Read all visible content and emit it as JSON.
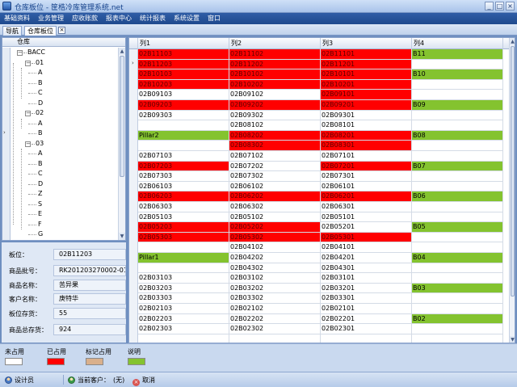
{
  "window": {
    "title": "仓库板位 - 筐梏冷库管理系统.net",
    "controls": [
      "_",
      "□",
      "×"
    ]
  },
  "menu": [
    "基础资料",
    "业务管理",
    "应收账款",
    "报表中心",
    "统计报表",
    "系统设置",
    "窗口"
  ],
  "tabs": {
    "nav": "导航",
    "warehouse": "仓库板位"
  },
  "tree": {
    "header": "仓库",
    "nodes": [
      {
        "label": "BACC",
        "level": 0,
        "expander": "−"
      },
      {
        "label": "01",
        "level": 1,
        "expander": "−"
      },
      {
        "label": "A",
        "level": 2
      },
      {
        "label": "B",
        "level": 2
      },
      {
        "label": "C",
        "level": 2
      },
      {
        "label": "D",
        "level": 2
      },
      {
        "label": "02",
        "level": 1,
        "expander": "−"
      },
      {
        "label": "A",
        "level": 2
      },
      {
        "label": "B",
        "level": 2
      },
      {
        "label": "03",
        "level": 1,
        "expander": "−"
      },
      {
        "label": "A",
        "level": 2
      },
      {
        "label": "B",
        "level": 2
      },
      {
        "label": "C",
        "level": 2
      },
      {
        "label": "D",
        "level": 2
      },
      {
        "label": "Z",
        "level": 2
      },
      {
        "label": "S",
        "level": 2
      },
      {
        "label": "E",
        "level": 2
      },
      {
        "label": "F",
        "level": 2
      },
      {
        "label": "G",
        "level": 2
      }
    ],
    "pointer": "›",
    "pointer_row": 8
  },
  "info": [
    {
      "label": "板位：",
      "value": "02B11203"
    },
    {
      "label": "商品批号：",
      "value": "RK201203270002-01"
    },
    {
      "label": "商品名称：",
      "value": "苦异果"
    },
    {
      "label": "客户名称：",
      "value": "庚特华"
    },
    {
      "label": "板位存货：",
      "value": "55"
    },
    {
      "label": "商品总存货：",
      "value": "924"
    }
  ],
  "grid": {
    "columns": [
      "列1",
      "列2",
      "列3",
      "列4"
    ],
    "pointer": "›",
    "pointer_row": 1,
    "rows": [
      [
        {
          "t": "02B11103",
          "c": "red"
        },
        {
          "t": "02B11102",
          "c": "red"
        },
        {
          "t": "02B11101",
          "c": "red"
        },
        {
          "t": "B11",
          "c": "green"
        }
      ],
      [
        {
          "t": "02B11203",
          "c": "red"
        },
        {
          "t": "02B11202",
          "c": "red"
        },
        {
          "t": "02B11201",
          "c": "red"
        },
        {
          "t": "",
          "c": "white"
        }
      ],
      [
        {
          "t": "02B10103",
          "c": "red"
        },
        {
          "t": "02B10102",
          "c": "red"
        },
        {
          "t": "02B10101",
          "c": "red"
        },
        {
          "t": "B10",
          "c": "green"
        }
      ],
      [
        {
          "t": "02B10203",
          "c": "red"
        },
        {
          "t": "02B10202",
          "c": "red"
        },
        {
          "t": "02B10201",
          "c": "red"
        },
        {
          "t": "",
          "c": "white"
        }
      ],
      [
        {
          "t": "02B09103",
          "c": "white"
        },
        {
          "t": "02B09102",
          "c": "white"
        },
        {
          "t": "02B09101",
          "c": "red"
        },
        {
          "t": "",
          "c": "white"
        }
      ],
      [
        {
          "t": "02B09203",
          "c": "red"
        },
        {
          "t": "02B09202",
          "c": "red"
        },
        {
          "t": "02B09201",
          "c": "red"
        },
        {
          "t": "B09",
          "c": "green"
        }
      ],
      [
        {
          "t": "02B09303",
          "c": "white"
        },
        {
          "t": "02B09302",
          "c": "white"
        },
        {
          "t": "02B09301",
          "c": "white"
        },
        {
          "t": "",
          "c": "white"
        }
      ],
      [
        {
          "t": "",
          "c": "white"
        },
        {
          "t": "02B08102",
          "c": "white"
        },
        {
          "t": "02B08101",
          "c": "white"
        },
        {
          "t": "",
          "c": "white"
        }
      ],
      [
        {
          "t": "Pillar2",
          "c": "green"
        },
        {
          "t": "02B08202",
          "c": "red"
        },
        {
          "t": "02B08201",
          "c": "red"
        },
        {
          "t": "B08",
          "c": "green"
        }
      ],
      [
        {
          "t": "",
          "c": "white"
        },
        {
          "t": "02B08302",
          "c": "red"
        },
        {
          "t": "02B08301",
          "c": "red"
        },
        {
          "t": "",
          "c": "white"
        }
      ],
      [
        {
          "t": "02B07103",
          "c": "white"
        },
        {
          "t": "02B07102",
          "c": "white"
        },
        {
          "t": "02B07101",
          "c": "white"
        },
        {
          "t": "",
          "c": "white"
        }
      ],
      [
        {
          "t": "02B07203",
          "c": "red"
        },
        {
          "t": "02B07202",
          "c": "white"
        },
        {
          "t": "02B07201",
          "c": "red"
        },
        {
          "t": "B07",
          "c": "green"
        }
      ],
      [
        {
          "t": "02B07303",
          "c": "white"
        },
        {
          "t": "02B07302",
          "c": "white"
        },
        {
          "t": "02B07301",
          "c": "white"
        },
        {
          "t": "",
          "c": "white"
        }
      ],
      [
        {
          "t": "02B06103",
          "c": "white"
        },
        {
          "t": "02B06102",
          "c": "white"
        },
        {
          "t": "02B06101",
          "c": "white"
        },
        {
          "t": "",
          "c": "white"
        }
      ],
      [
        {
          "t": "02B06203",
          "c": "red"
        },
        {
          "t": "02B06202",
          "c": "red"
        },
        {
          "t": "02B06201",
          "c": "red"
        },
        {
          "t": "B06",
          "c": "green"
        }
      ],
      [
        {
          "t": "02B06303",
          "c": "white"
        },
        {
          "t": "02B06302",
          "c": "white"
        },
        {
          "t": "02B06301",
          "c": "white"
        },
        {
          "t": "",
          "c": "white"
        }
      ],
      [
        {
          "t": "02B05103",
          "c": "white"
        },
        {
          "t": "02B05102",
          "c": "white"
        },
        {
          "t": "02B05101",
          "c": "white"
        },
        {
          "t": "",
          "c": "white"
        }
      ],
      [
        {
          "t": "02B05203",
          "c": "red"
        },
        {
          "t": "02B05202",
          "c": "red"
        },
        {
          "t": "02B05201",
          "c": "white"
        },
        {
          "t": "B05",
          "c": "green"
        }
      ],
      [
        {
          "t": "02B05303",
          "c": "red"
        },
        {
          "t": "02B05302",
          "c": "red"
        },
        {
          "t": "02B05301",
          "c": "red"
        },
        {
          "t": "",
          "c": "white"
        }
      ],
      [
        {
          "t": "",
          "c": "white"
        },
        {
          "t": "02B04102",
          "c": "white"
        },
        {
          "t": "02B04101",
          "c": "white"
        },
        {
          "t": "",
          "c": "white"
        }
      ],
      [
        {
          "t": "Pillar1",
          "c": "green"
        },
        {
          "t": "02B04202",
          "c": "white"
        },
        {
          "t": "02B04201",
          "c": "white"
        },
        {
          "t": "B04",
          "c": "green"
        }
      ],
      [
        {
          "t": "",
          "c": "white"
        },
        {
          "t": "02B04302",
          "c": "white"
        },
        {
          "t": "02B04301",
          "c": "white"
        },
        {
          "t": "",
          "c": "white"
        }
      ],
      [
        {
          "t": "02B03103",
          "c": "white"
        },
        {
          "t": "02B03102",
          "c": "white"
        },
        {
          "t": "02B03101",
          "c": "white"
        },
        {
          "t": "",
          "c": "white"
        }
      ],
      [
        {
          "t": "02B03203",
          "c": "white"
        },
        {
          "t": "02B03202",
          "c": "white"
        },
        {
          "t": "02B03201",
          "c": "white"
        },
        {
          "t": "B03",
          "c": "green"
        }
      ],
      [
        {
          "t": "02B03303",
          "c": "white"
        },
        {
          "t": "02B03302",
          "c": "white"
        },
        {
          "t": "02B03301",
          "c": "white"
        },
        {
          "t": "",
          "c": "white"
        }
      ],
      [
        {
          "t": "02B02103",
          "c": "white"
        },
        {
          "t": "02B02102",
          "c": "white"
        },
        {
          "t": "02B02101",
          "c": "white"
        },
        {
          "t": "",
          "c": "white"
        }
      ],
      [
        {
          "t": "02B02203",
          "c": "white"
        },
        {
          "t": "02B02202",
          "c": "white"
        },
        {
          "t": "02B02201",
          "c": "white"
        },
        {
          "t": "B02",
          "c": "green"
        }
      ],
      [
        {
          "t": "02B02303",
          "c": "white"
        },
        {
          "t": "02B02302",
          "c": "white"
        },
        {
          "t": "02B02301",
          "c": "white"
        },
        {
          "t": "",
          "c": "white"
        }
      ],
      [
        {
          "t": "",
          "c": "white"
        },
        {
          "t": "",
          "c": "white"
        },
        {
          "t": "",
          "c": "white"
        },
        {
          "t": "",
          "c": "white"
        }
      ]
    ]
  },
  "legend": [
    {
      "label": "未占用",
      "color": "#ffffff"
    },
    {
      "label": "已占用",
      "color": "#ff0000"
    },
    {
      "label": "标记占用",
      "color": "#d9b08c"
    },
    {
      "label": "说明",
      "color": "#84c32f"
    }
  ],
  "status": {
    "user": "设计员",
    "customer_label": "当前客户：",
    "customer_value": "(无)",
    "cancel": "取消"
  },
  "colors": {
    "red": "#ff0000",
    "green": "#84c32f",
    "menubar": "#2f5da6"
  }
}
